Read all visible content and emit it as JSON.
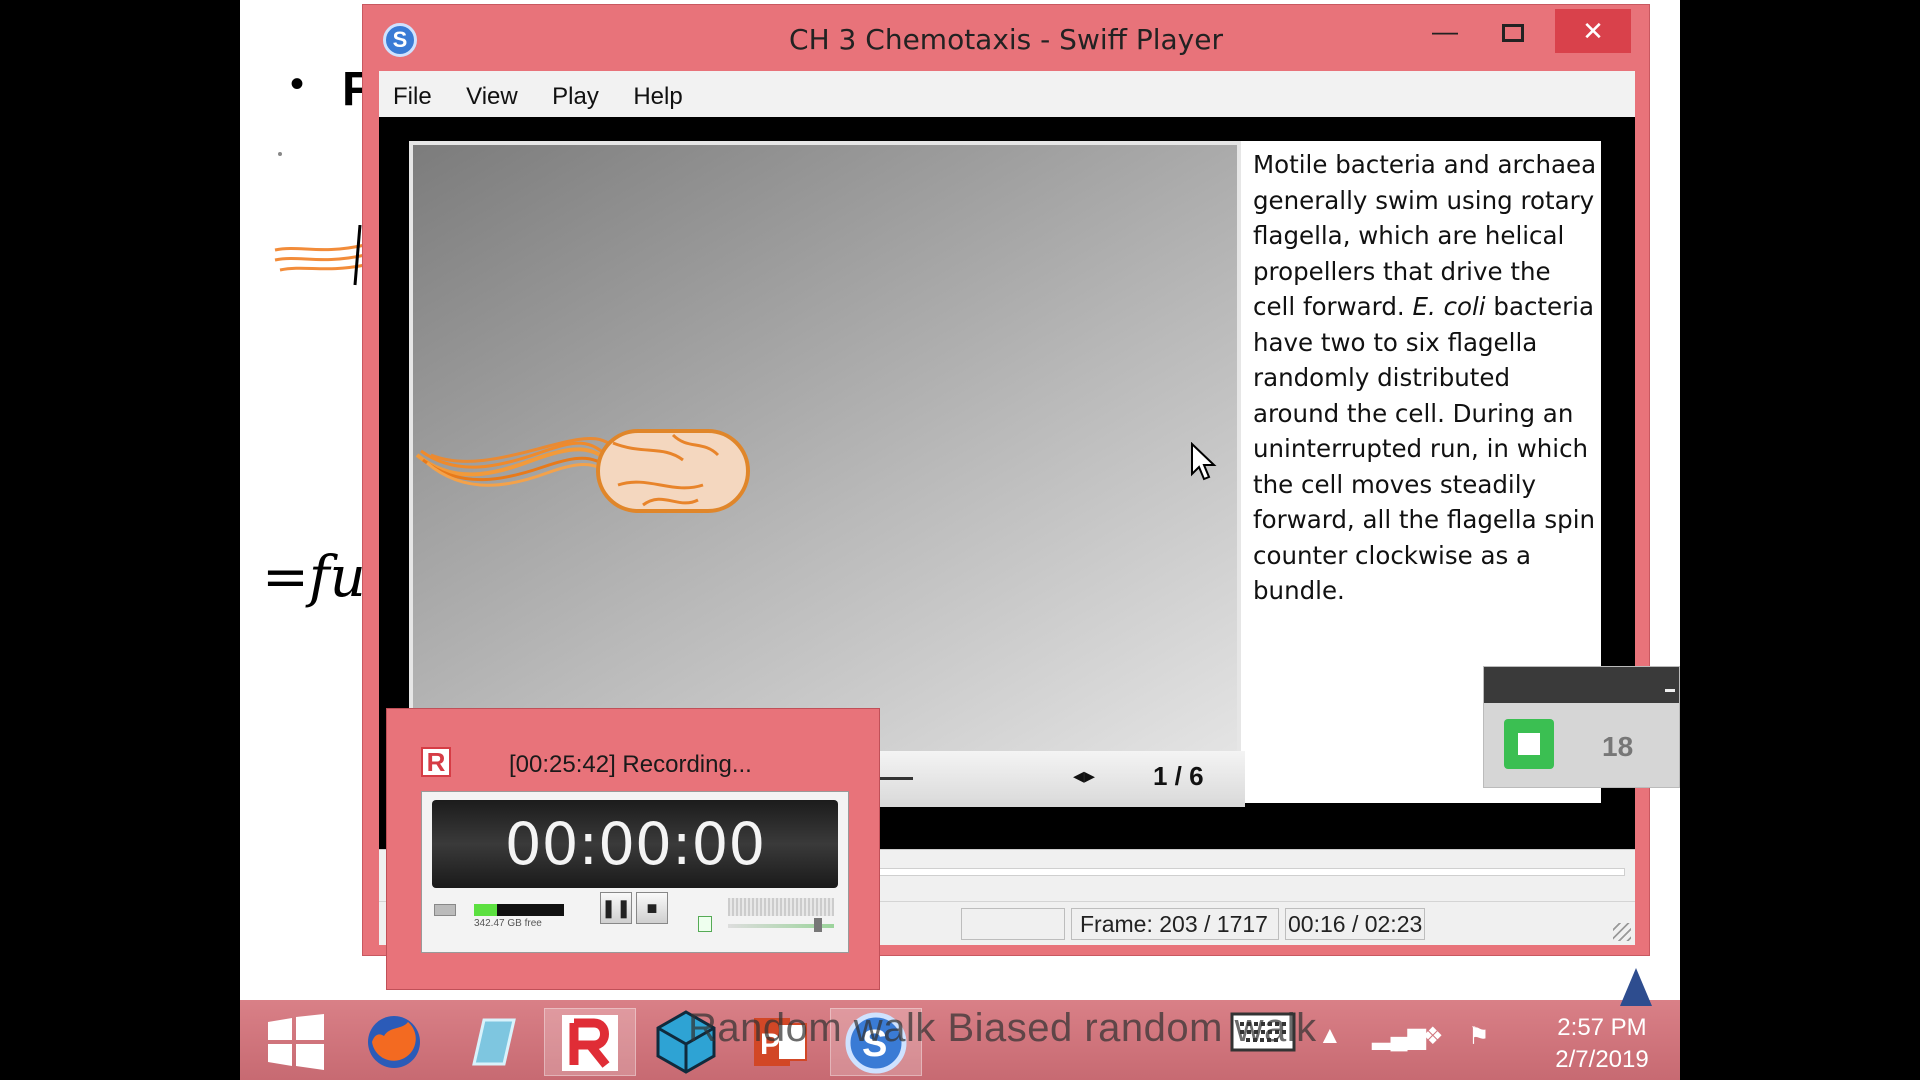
{
  "slide": {
    "bullet": "•",
    "letter": "F",
    "scribble": "=fu"
  },
  "swiff": {
    "title": "CH 3 Chemotaxis - Swiff Player",
    "icon_letter": "S",
    "menu": [
      "File",
      "View",
      "Play",
      "Help"
    ],
    "caption_parts": {
      "a": "Motile bacteria and archaea generally swim using rotary flagella, which are helical propellers that drive the cell forward. ",
      "italic": "E. coli",
      "b": " bacteria have two to six flagella randomly distributed around the cell. During an uninterrupted run, in which the cell moves steadily forward, all the flagella spin counter clockwise as a bundle."
    },
    "slide_counter": "1 / 6",
    "nav_arrows": "◂▸",
    "status": {
      "frame": "Frame: 203 / 1717",
      "time": "00:16 / 02:23"
    },
    "window_buttons": {
      "minimize": "—",
      "close": "✕"
    }
  },
  "recorder": {
    "logo": "R",
    "title": "[00:25:42] Recording...",
    "timer": "00:00:00",
    "level": 0.25,
    "free_space": "342.47 GB free",
    "pause_glyph": "❚❚",
    "stop_glyph": "■"
  },
  "side_widget": {
    "count": "18"
  },
  "taskbar": {
    "overlay_text": "Random walk   Biased random walk",
    "clock_time": "2:57 PM",
    "clock_date": "2/7/2019",
    "icons": [
      "windows-start-icon",
      "firefox-icon",
      "notepad-icon",
      "recorder-icon",
      "sketchup-icon",
      "powerpoint-icon",
      "swiff-player-icon"
    ]
  },
  "colors": {
    "window_frame": "#e8737a",
    "close_button": "#d9414b",
    "taskbar": "#d98087",
    "green_button": "#3bbf52"
  }
}
